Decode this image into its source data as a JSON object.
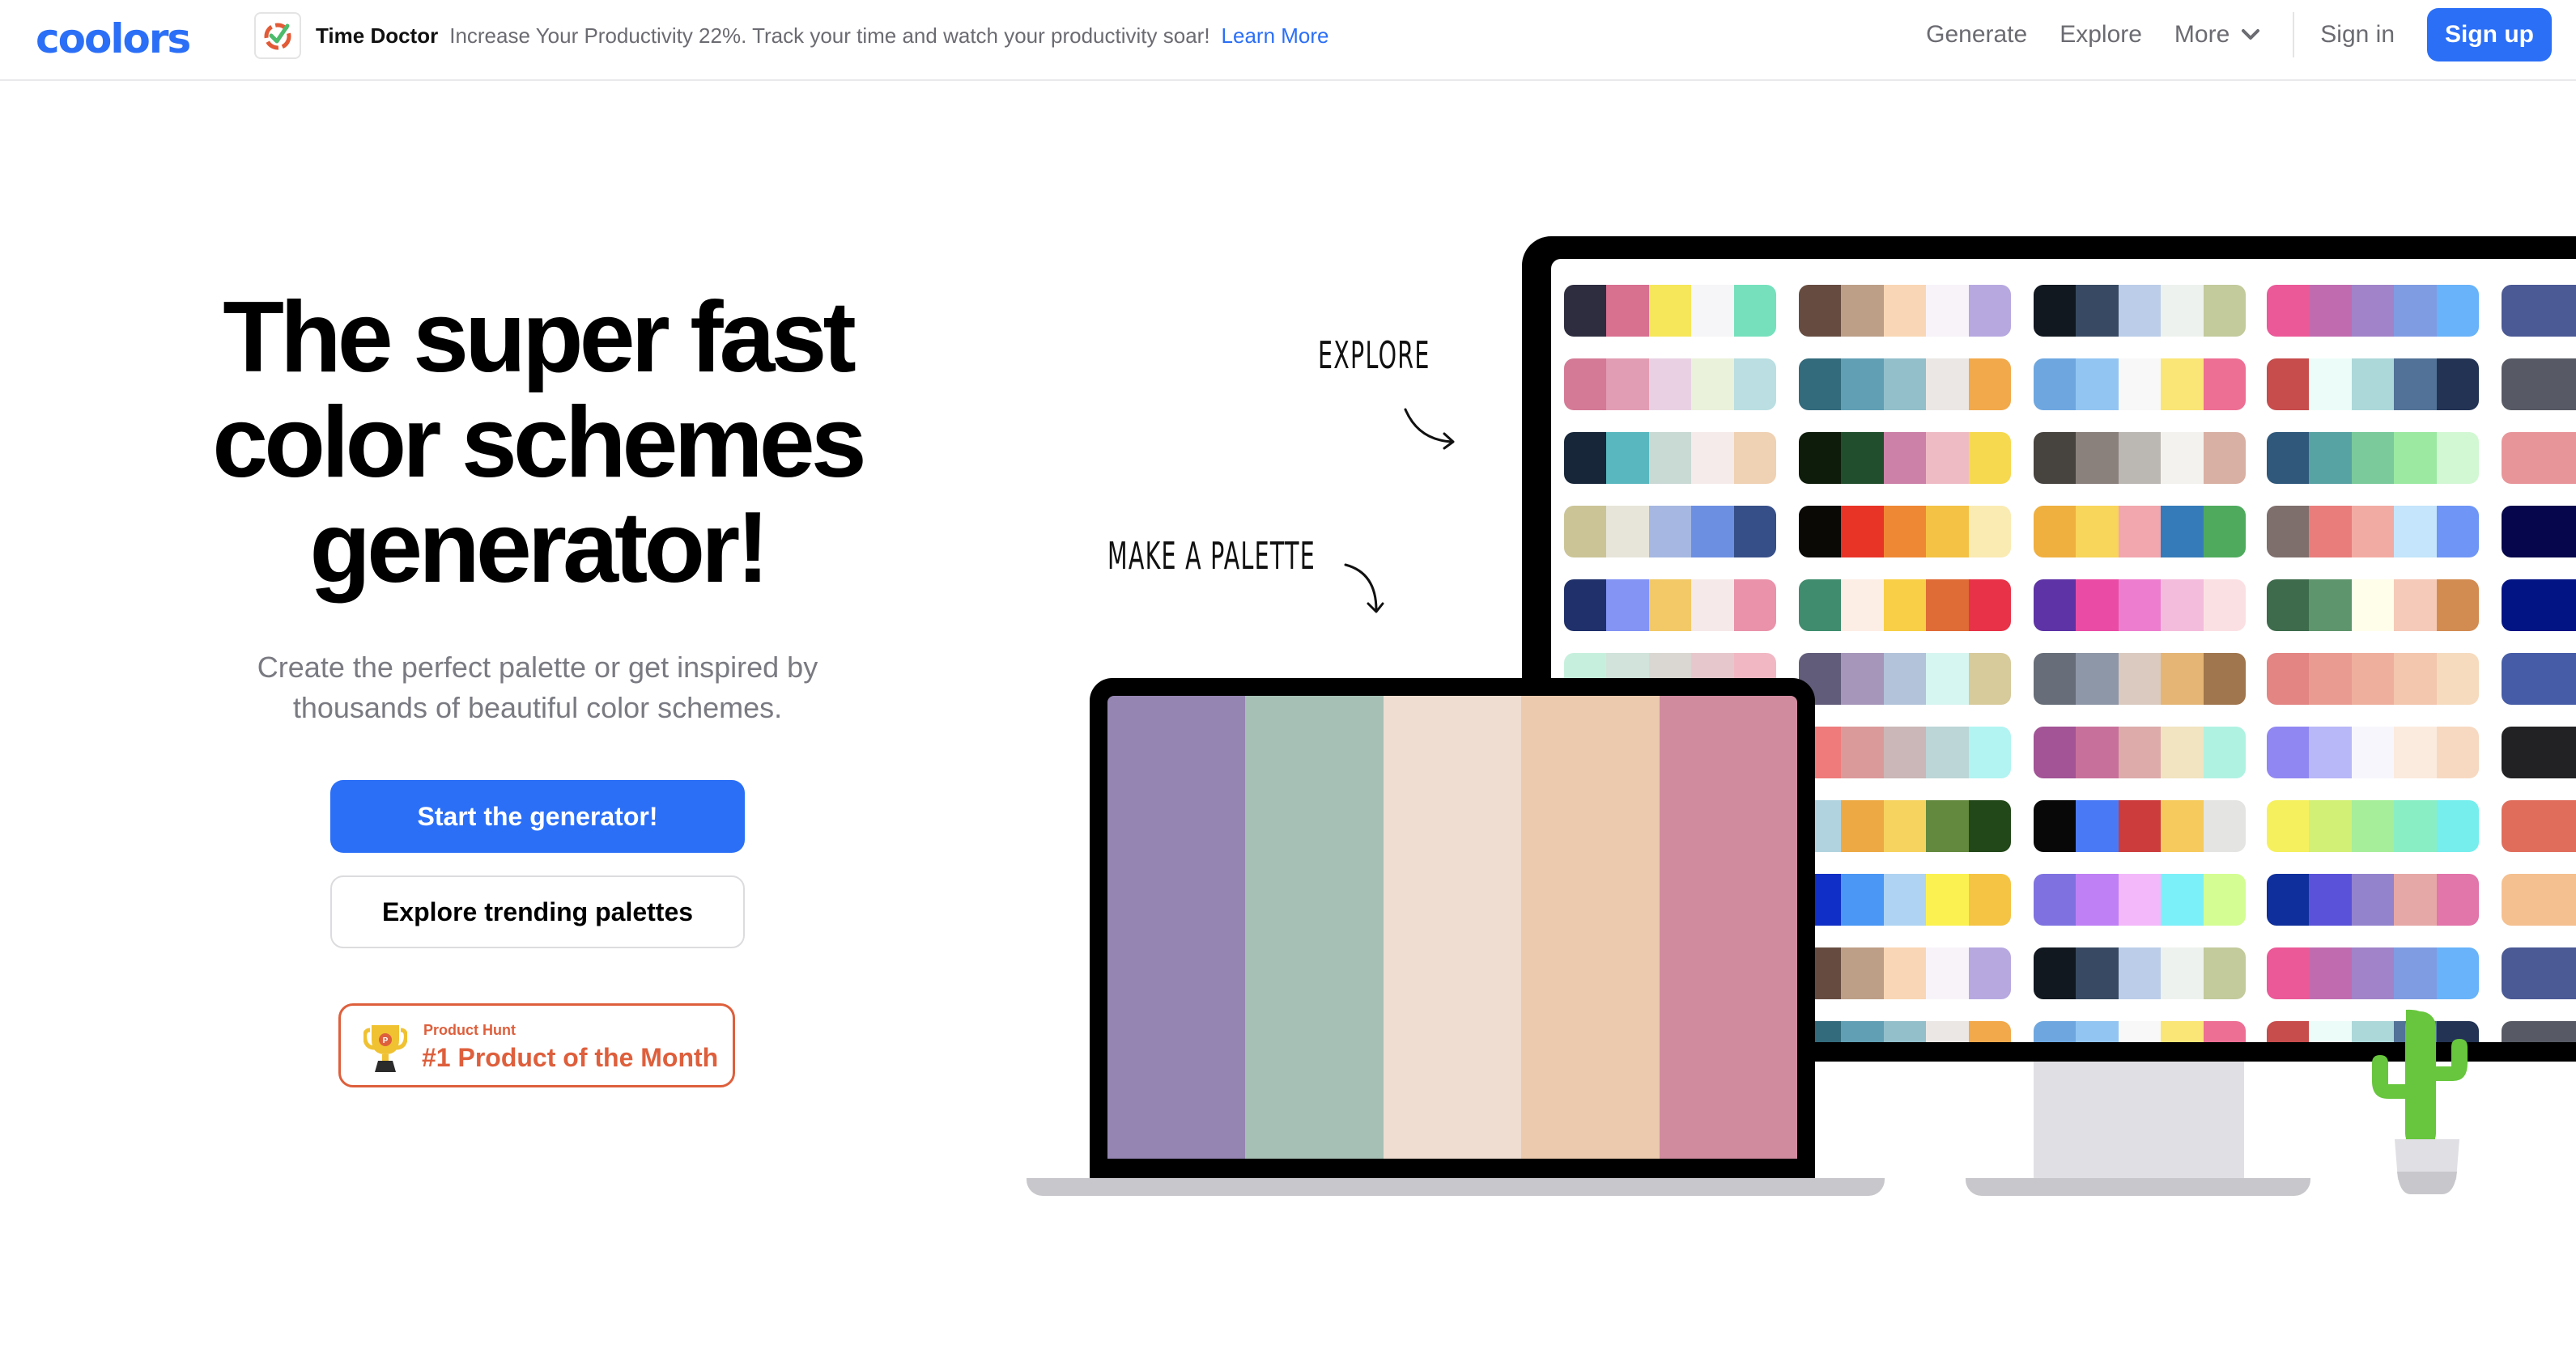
{
  "header": {
    "logo": "coolors",
    "ad": {
      "icon": "time-doctor-icon",
      "brand": "Time Doctor",
      "text": "Increase Your Productivity 22%. Track your time and watch your productivity soar!",
      "link": "Learn More"
    },
    "nav": {
      "generate": "Generate",
      "explore": "Explore",
      "more": "More",
      "sign_in": "Sign in",
      "sign_up": "Sign up"
    }
  },
  "hero": {
    "title_lines": [
      "The super fast",
      "color schemes",
      "generator!"
    ],
    "subtitle_lines": [
      "Create the perfect palette or get inspired by",
      "thousands of beautiful color schemes."
    ],
    "primary_button": "Start the generator!",
    "secondary_button": "Explore trending palettes",
    "badge": {
      "small": "Product Hunt",
      "big": "#1 Product of the Month"
    }
  },
  "illustration": {
    "label_explore": "EXPLORE",
    "label_make": "MAKE A PALETTE",
    "laptop_palette": [
      "#9585b2",
      "#a7c0b5",
      "#efddd1",
      "#ebcaad",
      "#d08b9f"
    ],
    "monitor_palettes": [
      [
        [
          "#2e2d40",
          "#d87090",
          "#f6e65a",
          "#f6f5f7",
          "#76e0bd"
        ],
        [
          "#664c40",
          "#bd9f87",
          "#f9d6b5",
          "#f8f3f9",
          "#b7a8e0"
        ],
        [
          "#111820",
          "#384a63",
          "#bbcde9",
          "#eef2ee",
          "#c3ca9c"
        ],
        [
          "#eb5998",
          "#c06bb0",
          "#a083c8",
          "#7f9ce3",
          "#68b3f9"
        ],
        [
          "#4b5995"
        ]
      ],
      [
        [
          "#d47a96",
          "#e19db3",
          "#e9d1e3",
          "#eaf2db",
          "#badee1"
        ],
        [
          "#336a7c",
          "#619fb4",
          "#93bfcb",
          "#ebe7e4",
          "#f2a94b"
        ],
        [
          "#6ea7e0",
          "#93c5f2",
          "#f8f8f8",
          "#fae577",
          "#ed6f94"
        ],
        [
          "#c74c4c",
          "#ecfdf9",
          "#acd8da",
          "#527297",
          "#233354"
        ],
        [
          "#575a64"
        ]
      ],
      [
        [
          "#172639",
          "#59b8bf",
          "#c9d9d4",
          "#f5ebea",
          "#efd1b3"
        ],
        [
          "#0e1c0b",
          "#214f2e",
          "#cb81a8",
          "#eebbc5",
          "#f7d94f"
        ],
        [
          "#47433e",
          "#8a817d",
          "#bbb8b4",
          "#f3f2ee",
          "#d9b0a4"
        ],
        [
          "#2f587b",
          "#57a2a3",
          "#7aca9b",
          "#9ce9a2",
          "#d2f8d3"
        ],
        [
          "#e8959a"
        ]
      ],
      [
        [
          "#cbc497",
          "#e7e5da",
          "#a6b8e1",
          "#6c8fe1",
          "#374f88"
        ],
        [
          "#0b0906",
          "#e83426",
          "#ef8835",
          "#f4c245",
          "#faebb3"
        ],
        [
          "#efb040",
          "#f8d55b",
          "#f1a7ad",
          "#367bb9",
          "#4faa5e"
        ],
        [
          "#7e6f6c",
          "#e87d7b",
          "#f2aba3",
          "#c4e5fb",
          "#6f96f6"
        ],
        [
          "#06064c"
        ]
      ],
      [
        [
          "#20306b",
          "#8394f5",
          "#f2c966",
          "#f6e9ea",
          "#e992aa"
        ],
        [
          "#3f8c6e",
          "#fcede5",
          "#f8cf46",
          "#df6b36",
          "#e73248"
        ],
        [
          "#5d33a5",
          "#ea4ba4",
          "#ed7ecf",
          "#f4bcdc",
          "#fbe0e3"
        ],
        [
          "#3d6b4c",
          "#5f956c",
          "#fefeeb",
          "#f5cab8",
          "#d28c52"
        ],
        [
          "#021384"
        ]
      ],
      [
        [
          "#c6f0dd",
          "#d1e3da",
          "#dad6d1",
          "#e6c8cc",
          "#f1b8c4"
        ],
        [
          "#625c7b",
          "#a696ba",
          "#b2c3da",
          "#d6f6f1",
          "#d7ca9b"
        ],
        [
          "#676e79",
          "#8e97a7",
          "#dacac0",
          "#e4b575",
          "#a0764e"
        ],
        [
          "#e28583",
          "#e99b91",
          "#efaf9d",
          "#f3c6ae",
          "#f6dbbf"
        ],
        [
          "#465ca7"
        ]
      ],
      [
        [
          "#ef7b7b",
          "#db9a9a",
          "#cbb7b7",
          "#bcd5d7",
          "#b1f4f2"
        ],
        [
          "#a25496",
          "#c8709c",
          "#dcabaa",
          "#f2e3c1",
          "#b0f2e2"
        ],
        [
          "#9187f2",
          "#b8b7f8",
          "#f7f6fd",
          "#fbebde",
          "#f7d9c1"
        ],
        [
          "#222123"
        ]
      ],
      [
        [
          "#b1d3df",
          "#eda944",
          "#f6d25f",
          "#63893e",
          "#224719"
        ],
        [
          "#080808",
          "#4a79f5",
          "#cc3c3d",
          "#f6ca5c",
          "#e4e5e3"
        ],
        [
          "#f5f05e",
          "#d2ef76",
          "#a6ee9a",
          "#8aeec5",
          "#76eeee"
        ],
        [
          "#e06d5c"
        ]
      ],
      [
        [
          "#0f2fc6",
          "#4a97f5",
          "#afd3f2",
          "#fbf251",
          "#f6c444"
        ],
        [
          "#7f72e0",
          "#bf80f5",
          "#f2b8f9",
          "#7cf0f8",
          "#d4fd93"
        ],
        [
          "#0f2f9c",
          "#5a53d9",
          "#9383cd",
          "#e5a8a6",
          "#e275aa"
        ],
        [
          "#f5c08f"
        ]
      ],
      [
        [
          "#664c40",
          "#bd9f87",
          "#f9d6b5",
          "#f8f3f9",
          "#b7a8e0"
        ],
        [
          "#111820",
          "#384a63",
          "#bbcde9",
          "#eef2ee",
          "#c3ca9c"
        ],
        [
          "#eb5998",
          "#c06bb0",
          "#a083c8",
          "#7f9ce3",
          "#68b3f9"
        ],
        [
          "#4b5995"
        ]
      ],
      [
        [
          "#336a7c",
          "#619fb4",
          "#93bfcb",
          "#ebe7e4",
          "#f2a94b"
        ],
        [
          "#6ea7e0",
          "#93c5f2",
          "#f8f8f8",
          "#fae577",
          "#ed6f94"
        ],
        [
          "#c74c4c",
          "#ecfdf9",
          "#acd8da",
          "#527297",
          "#233354"
        ],
        [
          "#575a64"
        ]
      ]
    ],
    "monitor_palettes_note_offsets": [
      0,
      0,
      0,
      0,
      0,
      0,
      1,
      1,
      1,
      1,
      1
    ]
  },
  "colors": {
    "brand_blue": "#2b6ff7",
    "product_hunt_orange": "#de5f3c",
    "muted_text": "#7a7a82",
    "cactus_green": "#67c63d"
  }
}
